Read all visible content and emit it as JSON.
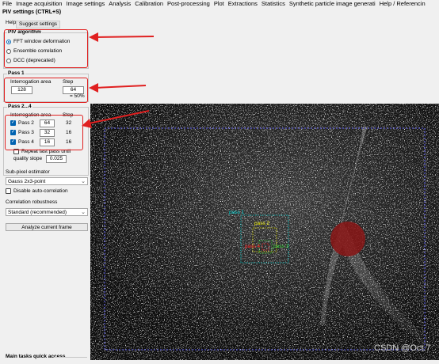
{
  "menubar": [
    "File",
    "Image acquisition",
    "Image settings",
    "Analysis",
    "Calibration",
    "Post-processing",
    "Plot",
    "Extractions",
    "Statistics",
    "Synthetic particle image generati",
    "Help / Referencin"
  ],
  "panel": {
    "title": "PIV settings (CTRL+S)",
    "help_label": "Help:",
    "suggest_button": "Suggest settings",
    "algorithm": {
      "title": "PIV algorithm",
      "options": [
        "FFT window deformation",
        "Ensemble correlation",
        "DCC (deprecated)"
      ],
      "selected": "FFT window deformation"
    },
    "pass1": {
      "title": "Pass 1",
      "area_label": "Interrogation area",
      "step_label": "Step",
      "area_value": "128",
      "step_value": "64",
      "overlap": "= 50%"
    },
    "pass2_4": {
      "title": "Pass 2...4",
      "area_label": "Interrogation area",
      "step_label": "Step",
      "rows": [
        {
          "label": "Pass 2",
          "area": "64",
          "step": "32",
          "checked": true
        },
        {
          "label": "Pass 3",
          "area": "32",
          "step": "16",
          "checked": true
        },
        {
          "label": "Pass 4",
          "area": "16",
          "step": "16",
          "checked": true
        }
      ],
      "repeat_label": "Repeat last pass until",
      "quality_label": "quality slope",
      "quality_value": "0.025"
    },
    "subpixel": {
      "label": "Sub-pixel estimator",
      "value": "Gauss 2x3-point"
    },
    "disable_autocorr": "Disable auto-correlation",
    "robustness": {
      "label": "Correlation robustness",
      "value": "Standard (recommended)"
    },
    "analyze_button": "Analyze current frame",
    "quick_access": "Main tasks quick access"
  },
  "overlay": {
    "pass1": "pass 1",
    "pass2": "pass 2",
    "pass3": "pass 3",
    "pass4": "pass 4",
    "watermark": "CSDN @Oct.7"
  },
  "colors": {
    "annotation": "#e02020",
    "pass1": "#00d0d0",
    "pass2": "#e8e800",
    "pass3": "#30d030",
    "pass4": "#ff2020",
    "roi": "#6a6aff",
    "accent": "#0063b1"
  }
}
